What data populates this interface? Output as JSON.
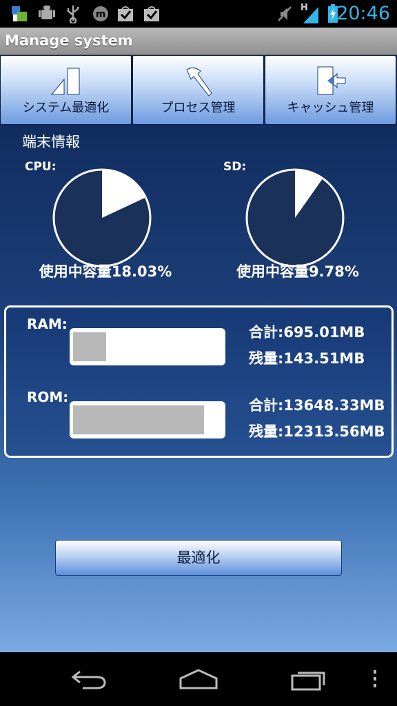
{
  "statusbar": {
    "time": "20:46",
    "network_type": "H",
    "icons": [
      "app-notification-icon",
      "android-debug-icon",
      "usb-icon",
      "messaging-icon",
      "download-complete-icon",
      "download-complete-icon",
      "mute-icon",
      "signal-icon",
      "battery-charging-icon"
    ]
  },
  "titlebar": {
    "title": "Manage system"
  },
  "tabs": [
    {
      "label": "システム最適化",
      "icon": "optimize-triangle-icon"
    },
    {
      "label": "プロセス管理",
      "icon": "hammer-icon"
    },
    {
      "label": "キャッシュ管理",
      "icon": "cache-exit-icon"
    }
  ],
  "device_info": {
    "title": "端末情報",
    "cpu": {
      "label": "CPU:",
      "usage_text": "使用中容量18.03%",
      "usage_percent": 18.03
    },
    "sd": {
      "label": "SD:",
      "usage_text": "使用中容量9.78%",
      "usage_percent": 9.78
    }
  },
  "memory": {
    "ram": {
      "label": "RAM:",
      "total": "合計:695.01MB",
      "remaining": "残量:143.51MB",
      "used_fraction": 0.22
    },
    "rom": {
      "label": "ROM:",
      "total": "合計:13648.33MB",
      "remaining": "残量:12313.56MB",
      "used_fraction": 0.88
    }
  },
  "optimize_button": {
    "label": "最適化"
  },
  "colors": {
    "accent": "#33b5e5",
    "pie_fill": "#1a3159",
    "button_dark": "#0a1a3a"
  },
  "navbar": {
    "buttons": [
      "back-icon",
      "home-icon",
      "recent-apps-icon",
      "menu-icon"
    ]
  }
}
